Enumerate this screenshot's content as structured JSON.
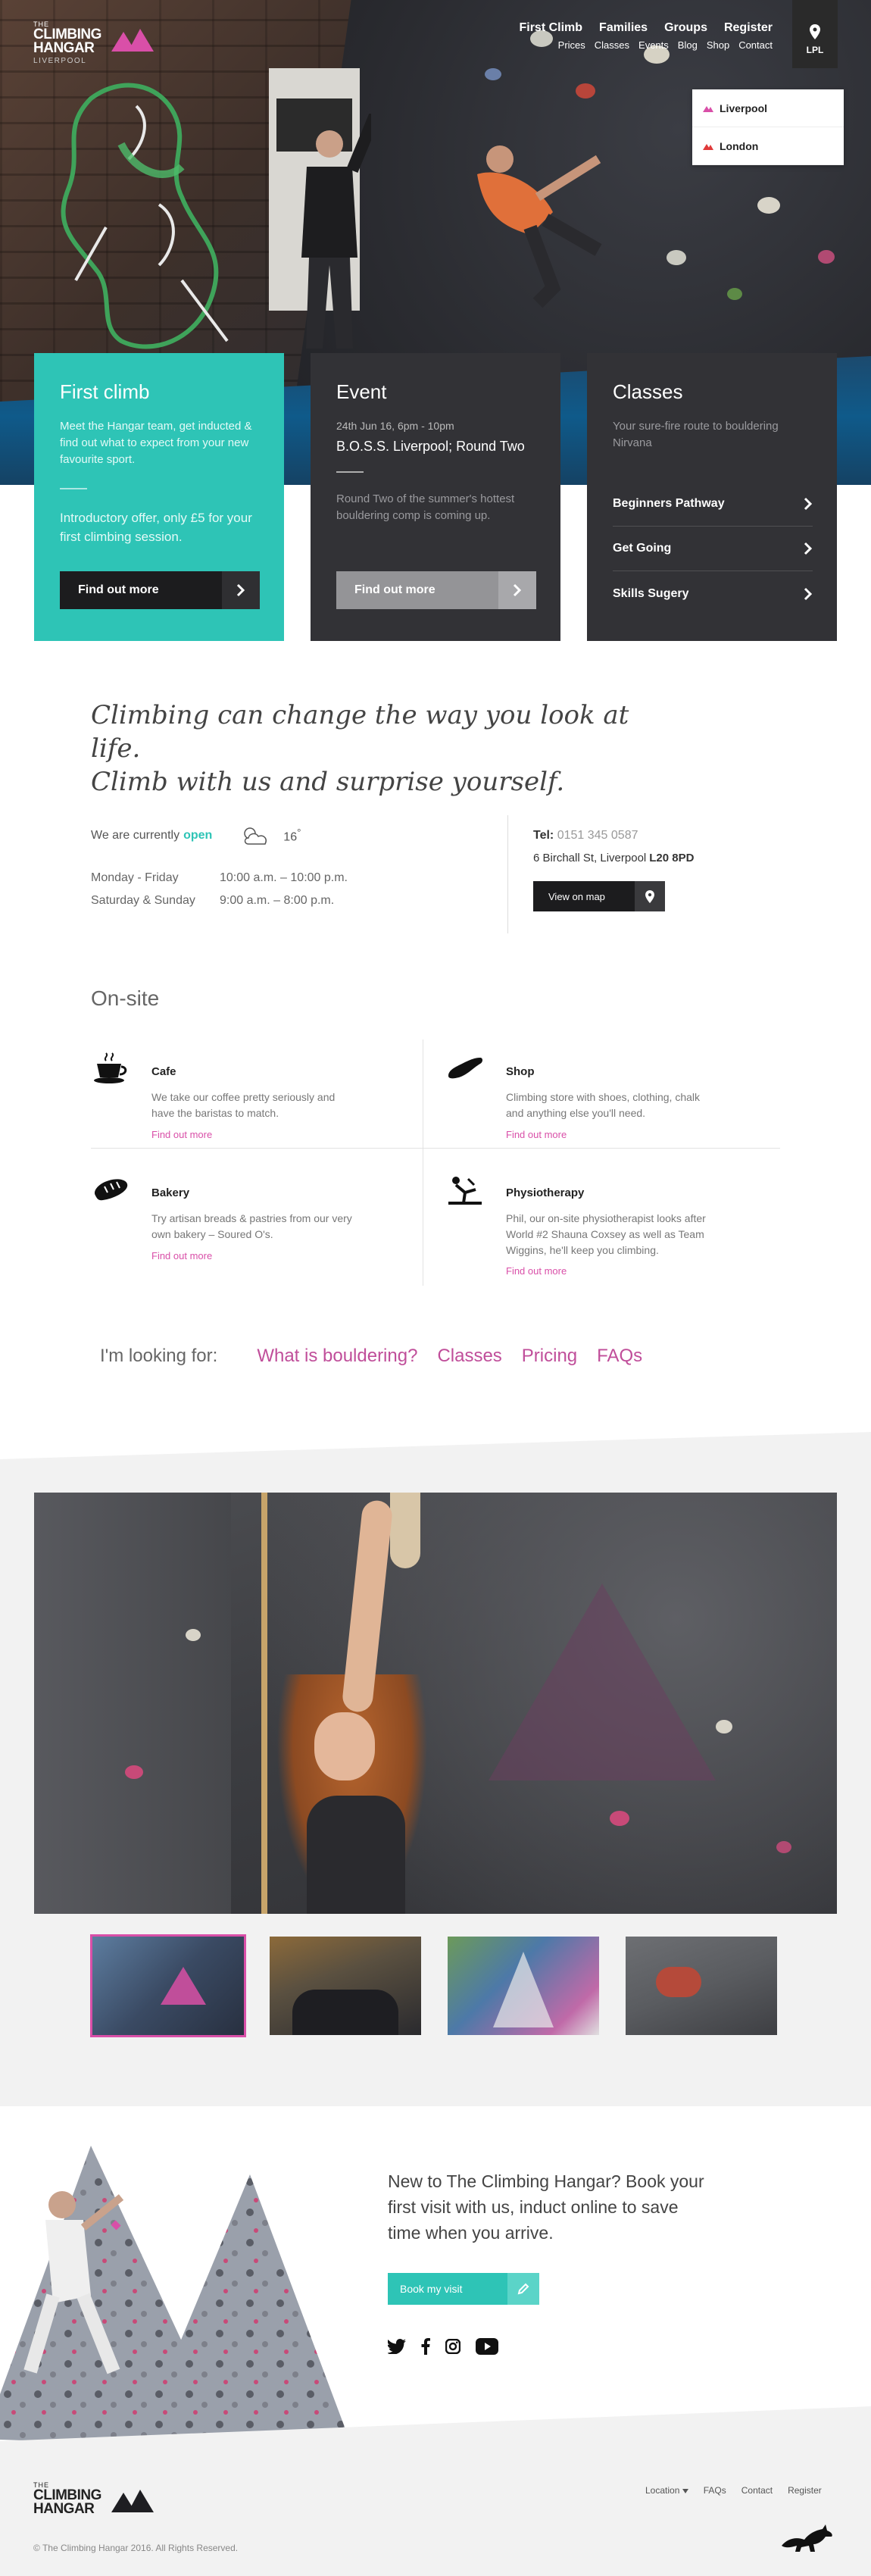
{
  "header": {
    "logo": {
      "the": "THE",
      "line1": "CLIMBING",
      "line2": "HANGAR",
      "city": "LIVERPOOL"
    },
    "nav_main": [
      "First Climb",
      "Families",
      "Groups",
      "Register"
    ],
    "nav_sub": [
      "Prices",
      "Classes",
      "Events",
      "Blog",
      "Shop",
      "Contact"
    ],
    "location_code": "LPL",
    "locations": [
      "Liverpool",
      "London"
    ]
  },
  "cards": {
    "first_climb": {
      "title": "First climb",
      "text": "Meet the Hangar team, get inducted & find out what to expect from your new favourite sport.",
      "offer": "Introductory offer, only £5 for your first climbing session.",
      "button": "Find out more"
    },
    "event": {
      "title": "Event",
      "date": "24th Jun 16, 6pm - 10pm",
      "name": "B.O.S.S. Liverpool; Round Two",
      "text": "Round Two of the summer's hottest bouldering comp is coming up.",
      "button": "Find out more"
    },
    "classes": {
      "title": "Classes",
      "text": "Your sure-fire route to bouldering Nirvana",
      "items": [
        "Beginners Pathway",
        "Get Going",
        "Skills Sugery"
      ]
    }
  },
  "quote": {
    "line1": "Climbing can change the way you look at life.",
    "line2": "Climb with us and surprise yourself."
  },
  "status": {
    "prefix": "We are currently",
    "state": "open",
    "temperature": "16",
    "degree": "°",
    "hours": [
      {
        "days": "Monday - Friday",
        "time": "10:00 a.m. – 10:00 p.m."
      },
      {
        "days": "Saturday & Sunday",
        "time": "9:00 a.m. – 8:00 p.m."
      }
    ]
  },
  "contact": {
    "tel_label": "Tel:",
    "tel": "0151 345 0587",
    "address": "6 Birchall St, Liverpool",
    "postcode": "L20 8PD",
    "map_button": "View on map"
  },
  "onsite": {
    "heading": "On-site",
    "services": [
      {
        "name": "Cafe",
        "desc": "We take our coffee pretty seriously and have the baristas to match.",
        "more": "Find out more"
      },
      {
        "name": "Shop",
        "desc": "Climbing store with shoes, clothing, chalk and anything else you'll need.",
        "more": "Find out more"
      },
      {
        "name": "Bakery",
        "desc": "Try artisan breads & pastries from our very own bakery – Soured O's.",
        "more": "Find out more"
      },
      {
        "name": "Physiotherapy",
        "desc": "Phil, our on-site physiotherapist looks after World #2 Shauna Coxsey as well as Team Wiggins, he'll keep you climbing.",
        "more": "Find out more"
      }
    ]
  },
  "looking_for": {
    "label": "I'm looking for:",
    "links": [
      "What is bouldering?",
      "Classes",
      "Pricing",
      "FAQs"
    ]
  },
  "book": {
    "text": "New to The Climbing Hangar? Book your first visit with us, induct online to save time when you arrive.",
    "button": "Book my visit"
  },
  "footer": {
    "links": [
      "Location",
      "FAQs",
      "Contact",
      "Register"
    ],
    "copyright": "© The Climbing Hangar 2016. All Rights Reserved."
  },
  "colors": {
    "teal": "#2ec4b6",
    "pink": "#d94fa8",
    "dark": "#323236"
  }
}
